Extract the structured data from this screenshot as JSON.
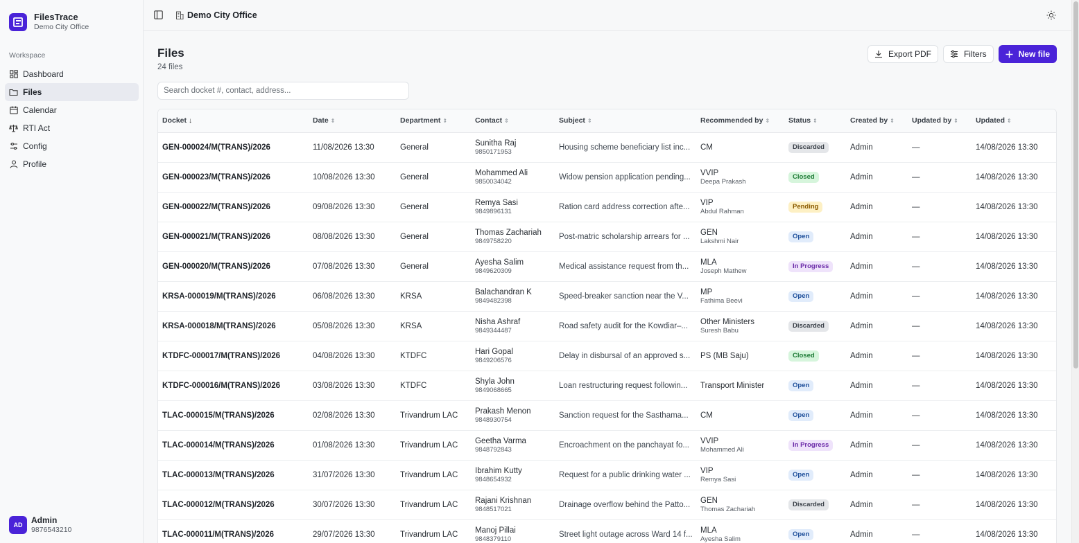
{
  "app": {
    "name": "FilesTrace",
    "office": "Demo City Office"
  },
  "sidebar": {
    "section": "Workspace",
    "items": [
      {
        "label": "Dashboard",
        "icon": "dashboard-icon"
      },
      {
        "label": "Files",
        "icon": "folder-icon",
        "active": true
      },
      {
        "label": "Calendar",
        "icon": "calendar-icon"
      },
      {
        "label": "RTI Act",
        "icon": "scale-icon"
      },
      {
        "label": "Config",
        "icon": "sliders-icon"
      },
      {
        "label": "Profile",
        "icon": "user-icon"
      }
    ],
    "user": {
      "initials": "AD",
      "name": "Admin",
      "phone": "9876543210"
    }
  },
  "topbar": {
    "breadcrumb": "Demo City Office"
  },
  "page": {
    "title": "Files",
    "count": "24 files",
    "export_label": "Export PDF",
    "filters_label": "Filters",
    "new_label": "New file",
    "search_placeholder": "Search docket #, contact, address..."
  },
  "colors": {
    "accent": "#4a23d8"
  },
  "table": {
    "columns": [
      "Docket",
      "Date",
      "Department",
      "Contact",
      "Subject",
      "Recommended by",
      "Status",
      "Created by",
      "Updated by",
      "Updated"
    ],
    "rows": [
      {
        "docket": "GEN-000024/M(TRANS)/2026",
        "date": "11/08/2026 13:30",
        "department": "General",
        "contact": "Sunitha Raj",
        "phone": "9850171953",
        "subject": "Housing scheme beneficiary list inc...",
        "rec": "CM",
        "rec_by": "",
        "status": "Discarded",
        "created": "Admin",
        "updated_by": "—",
        "updated": "14/08/2026 13:30"
      },
      {
        "docket": "GEN-000023/M(TRANS)/2026",
        "date": "10/08/2026 13:30",
        "department": "General",
        "contact": "Mohammed Ali",
        "phone": "9850034042",
        "subject": "Widow pension application pending...",
        "rec": "VVIP",
        "rec_by": "Deepa Prakash",
        "status": "Closed",
        "created": "Admin",
        "updated_by": "—",
        "updated": "14/08/2026 13:30"
      },
      {
        "docket": "GEN-000022/M(TRANS)/2026",
        "date": "09/08/2026 13:30",
        "department": "General",
        "contact": "Remya Sasi",
        "phone": "9849896131",
        "subject": "Ration card address correction afte...",
        "rec": "VIP",
        "rec_by": "Abdul Rahman",
        "status": "Pending",
        "created": "Admin",
        "updated_by": "—",
        "updated": "14/08/2026 13:30"
      },
      {
        "docket": "GEN-000021/M(TRANS)/2026",
        "date": "08/08/2026 13:30",
        "department": "General",
        "contact": "Thomas Zachariah",
        "phone": "9849758220",
        "subject": "Post-matric scholarship arrears for ...",
        "rec": "GEN",
        "rec_by": "Lakshmi Nair",
        "status": "Open",
        "created": "Admin",
        "updated_by": "—",
        "updated": "14/08/2026 13:30"
      },
      {
        "docket": "GEN-000020/M(TRANS)/2026",
        "date": "07/08/2026 13:30",
        "department": "General",
        "contact": "Ayesha Salim",
        "phone": "9849620309",
        "subject": "Medical assistance request from th...",
        "rec": "MLA",
        "rec_by": "Joseph Mathew",
        "status": "In Progress",
        "created": "Admin",
        "updated_by": "—",
        "updated": "14/08/2026 13:30"
      },
      {
        "docket": "KRSA-000019/M(TRANS)/2026",
        "date": "06/08/2026 13:30",
        "department": "KRSA",
        "contact": "Balachandran K",
        "phone": "9849482398",
        "subject": "Speed-breaker sanction near the V...",
        "rec": "MP",
        "rec_by": "Fathima Beevi",
        "status": "Open",
        "created": "Admin",
        "updated_by": "—",
        "updated": "14/08/2026 13:30"
      },
      {
        "docket": "KRSA-000018/M(TRANS)/2026",
        "date": "05/08/2026 13:30",
        "department": "KRSA",
        "contact": "Nisha Ashraf",
        "phone": "9849344487",
        "subject": "Road safety audit for the Kowdiar–...",
        "rec": "Other Ministers",
        "rec_by": "Suresh Babu",
        "status": "Discarded",
        "created": "Admin",
        "updated_by": "—",
        "updated": "14/08/2026 13:30"
      },
      {
        "docket": "KTDFC-000017/M(TRANS)/2026",
        "date": "04/08/2026 13:30",
        "department": "KTDFC",
        "contact": "Hari Gopal",
        "phone": "9849206576",
        "subject": "Delay in disbursal of an approved s...",
        "rec": "PS (MB Saju)",
        "rec_by": "",
        "status": "Closed",
        "created": "Admin",
        "updated_by": "—",
        "updated": "14/08/2026 13:30"
      },
      {
        "docket": "KTDFC-000016/M(TRANS)/2026",
        "date": "03/08/2026 13:30",
        "department": "KTDFC",
        "contact": "Shyla John",
        "phone": "9849068665",
        "subject": "Loan restructuring request followin...",
        "rec": "Transport Minister",
        "rec_by": "",
        "status": "Open",
        "created": "Admin",
        "updated_by": "—",
        "updated": "14/08/2026 13:30"
      },
      {
        "docket": "TLAC-000015/M(TRANS)/2026",
        "date": "02/08/2026 13:30",
        "department": "Trivandrum LAC",
        "contact": "Prakash Menon",
        "phone": "9848930754",
        "subject": "Sanction request for the Sasthama...",
        "rec": "CM",
        "rec_by": "",
        "status": "Open",
        "created": "Admin",
        "updated_by": "—",
        "updated": "14/08/2026 13:30"
      },
      {
        "docket": "TLAC-000014/M(TRANS)/2026",
        "date": "01/08/2026 13:30",
        "department": "Trivandrum LAC",
        "contact": "Geetha Varma",
        "phone": "9848792843",
        "subject": "Encroachment on the panchayat fo...",
        "rec": "VVIP",
        "rec_by": "Mohammed Ali",
        "status": "In Progress",
        "created": "Admin",
        "updated_by": "—",
        "updated": "14/08/2026 13:30"
      },
      {
        "docket": "TLAC-000013/M(TRANS)/2026",
        "date": "31/07/2026 13:30",
        "department": "Trivandrum LAC",
        "contact": "Ibrahim Kutty",
        "phone": "9848654932",
        "subject": "Request for a public drinking water ...",
        "rec": "VIP",
        "rec_by": "Remya Sasi",
        "status": "Open",
        "created": "Admin",
        "updated_by": "—",
        "updated": "14/08/2026 13:30"
      },
      {
        "docket": "TLAC-000012/M(TRANS)/2026",
        "date": "30/07/2026 13:30",
        "department": "Trivandrum LAC",
        "contact": "Rajani Krishnan",
        "phone": "9848517021",
        "subject": "Drainage overflow behind the Patto...",
        "rec": "GEN",
        "rec_by": "Thomas Zachariah",
        "status": "Discarded",
        "created": "Admin",
        "updated_by": "—",
        "updated": "14/08/2026 13:30"
      },
      {
        "docket": "TLAC-000011/M(TRANS)/2026",
        "date": "29/07/2026 13:30",
        "department": "Trivandrum LAC",
        "contact": "Manoj Pillai",
        "phone": "9848379110",
        "subject": "Street light outage across Ward 14 f...",
        "rec": "MLA",
        "rec_by": "Ayesha Salim",
        "status": "Open",
        "created": "Admin",
        "updated_by": "—",
        "updated": "14/08/2026 13:30"
      }
    ]
  },
  "status_colors": {
    "Discarded": {
      "bg": "#e4e6e9",
      "fg": "#3a4048"
    },
    "Closed": {
      "bg": "#d6f5dc",
      "fg": "#1d7a35"
    },
    "Pending": {
      "bg": "#fdf0c4",
      "fg": "#8a5a00"
    },
    "Open": {
      "bg": "#e1ecfb",
      "fg": "#1e4f9a"
    },
    "In Progress": {
      "bg": "#efe3fb",
      "fg": "#6b2aa8"
    }
  }
}
